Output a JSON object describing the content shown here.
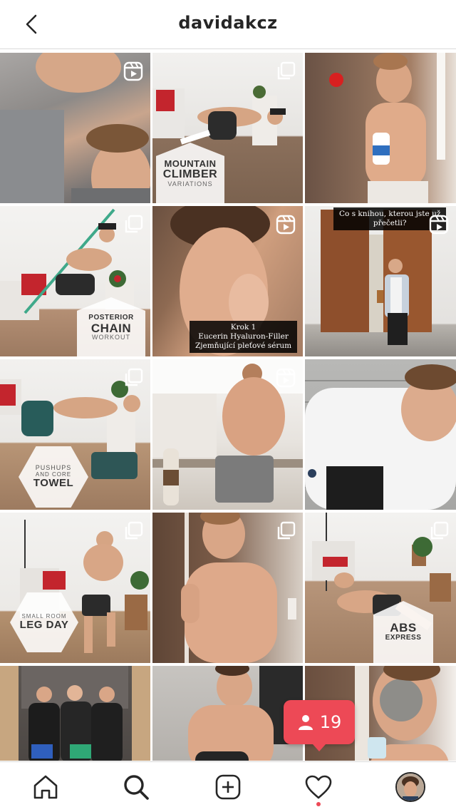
{
  "header": {
    "username": "davidakcz"
  },
  "posts": [
    {
      "media_icon": "reels-icon",
      "label": null,
      "caption": null
    },
    {
      "media_icon": "multiple-posts-icon",
      "label": {
        "top": "MOUNTAIN",
        "mid": "CLIMBER",
        "bottom": "VARIATIONS"
      },
      "caption": null
    },
    {
      "media_icon": null,
      "label": null,
      "caption": null
    },
    {
      "media_icon": "multiple-posts-icon",
      "label": {
        "top": "POSTERIOR",
        "mid": "CHAIN",
        "bottom": "WORKOUT"
      },
      "caption": null
    },
    {
      "media_icon": "reels-icon",
      "label": null,
      "caption": [
        "Krok 1",
        "Eucerin Hyaluron-Filler",
        "Zjemňující pleťové sérum"
      ]
    },
    {
      "media_icon": "reels-icon",
      "label": null,
      "caption": [
        "Co s knihou, kterou jste už",
        "přečetli?"
      ]
    },
    {
      "media_icon": "multiple-posts-icon",
      "label": {
        "top": "PUSHUPS",
        "mid": "AND CORE",
        "bottom": "TOWEL"
      },
      "caption": null
    },
    {
      "media_icon": "reels-icon",
      "label": null,
      "caption": null
    },
    {
      "media_icon": null,
      "label": null,
      "caption": null
    },
    {
      "media_icon": "multiple-posts-icon",
      "label": {
        "top": "SMALL ROOM",
        "mid": "LEG DAY",
        "bottom": ""
      },
      "caption": null
    },
    {
      "media_icon": "multiple-posts-icon",
      "label": null,
      "caption": null
    },
    {
      "media_icon": "multiple-posts-icon",
      "label": {
        "top": "",
        "mid": "ABS",
        "bottom": "EXPRESS"
      },
      "caption": null
    },
    {
      "media_icon": null,
      "label": null,
      "caption": null
    },
    {
      "media_icon": null,
      "label": null,
      "caption": null
    },
    {
      "media_icon": null,
      "label": null,
      "caption": null
    }
  ],
  "notification": {
    "icon": "person-icon",
    "count": "19"
  },
  "tabbar": {
    "items": [
      "home-icon",
      "search-icon",
      "new-post-icon",
      "activity-heart-icon",
      "profile-avatar"
    ]
  },
  "colors": {
    "accent": "#ed4956",
    "text": "#262626",
    "divider": "#dbdbdb"
  }
}
